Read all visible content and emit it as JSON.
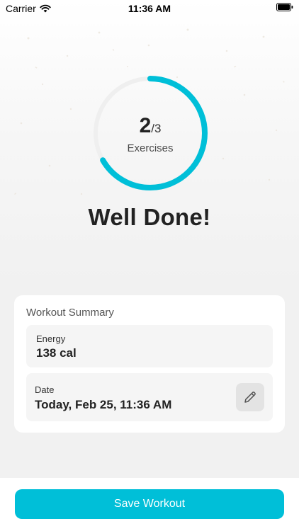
{
  "status_bar": {
    "carrier": "Carrier",
    "time": "11:36 AM",
    "icons": [
      "wifi-icon",
      "battery-icon"
    ]
  },
  "progress": {
    "completed": "2",
    "total": "/3",
    "label": "Exercises",
    "fraction": 0.667,
    "ring_color": "#00bfd8",
    "track_color": "#efefef"
  },
  "headline": "Well Done!",
  "summary": {
    "title": "Workout Summary",
    "energy": {
      "label": "Energy",
      "value": "138 cal"
    },
    "date": {
      "label": "Date",
      "value": "Today, Feb 25, 11:36 AM",
      "edit_icon": "pencil-icon"
    }
  },
  "actions": {
    "save_label": "Save Workout",
    "accent": "#00bfd8"
  }
}
